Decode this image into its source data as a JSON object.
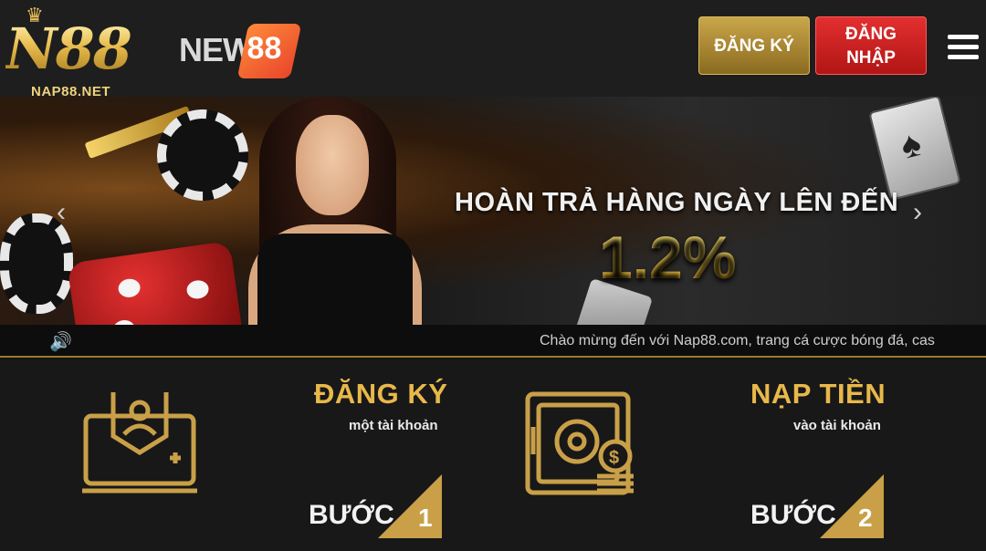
{
  "header": {
    "logo_primary": "N88",
    "logo_primary_site": "NAP88.NET",
    "logo_secondary_text": "NEW",
    "logo_secondary_badge": "88",
    "register_button": "ĐĂNG KÝ",
    "login_button_line1": "ĐĂNG",
    "login_button_line2": "NHẬP",
    "menu_icon": "hamburger-icon"
  },
  "banner": {
    "promo_line1": "HOÀN TRẢ HÀNG NGÀY LÊN ĐẾN",
    "promo_line2": "1.2%",
    "prev_arrow": "‹",
    "next_arrow": "›"
  },
  "marquee": {
    "speaker_icon": "speaker-icon",
    "text": "Chào mừng đến với Nap88.com, trang cá cược bóng đá, cas"
  },
  "steps": [
    {
      "title": "ĐĂNG KÝ",
      "subtitle": "một tài khoản",
      "step_word": "BƯỚC",
      "number": "1",
      "icon": "laptop-user-icon"
    },
    {
      "title": "NẠP TIỀN",
      "subtitle": "vào tài khoản",
      "step_word": "BƯỚC",
      "number": "2",
      "icon": "safe-coins-icon"
    }
  ],
  "colors": {
    "gold": "#c9a048",
    "red_button": "#d22222",
    "background": "#181818"
  }
}
